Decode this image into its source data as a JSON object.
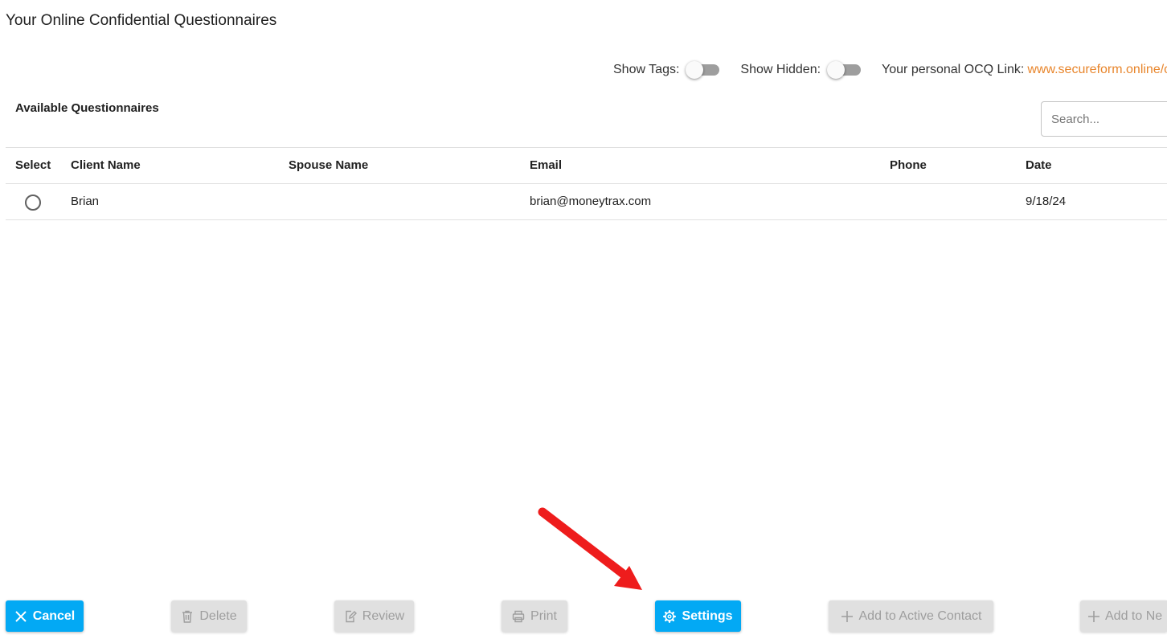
{
  "page": {
    "title": "Your Online Confidential Questionnaires"
  },
  "toolbar": {
    "show_tags_label": "Show Tags:",
    "show_tags_on": false,
    "show_hidden_label": "Show Hidden:",
    "show_hidden_on": false,
    "ocq_link_label": "Your personal OCQ Link:",
    "ocq_link_text": "www.secureform.online/c"
  },
  "section": {
    "title": "Available Questionnaires"
  },
  "search": {
    "placeholder": "Search...",
    "value": ""
  },
  "table": {
    "headers": {
      "select": "Select",
      "client_name": "Client Name",
      "spouse_name": "Spouse Name",
      "email": "Email",
      "phone": "Phone",
      "date": "Date"
    },
    "rows": [
      {
        "selected": false,
        "client_name": "Brian",
        "spouse_name": "",
        "email": "brian@moneytrax.com",
        "phone": "",
        "date": "9/18/24"
      }
    ]
  },
  "buttons": {
    "cancel": "Cancel",
    "delete": "Delete",
    "review": "Review",
    "print": "Print",
    "settings": "Settings",
    "add_active": "Add to Active Contact",
    "add_new": "Add to Ne"
  },
  "colors": {
    "accent": "#03a9f4",
    "link": "#e8852b",
    "annotation_arrow": "#ee1c1c",
    "disabled_bg": "#e0e0e0"
  }
}
